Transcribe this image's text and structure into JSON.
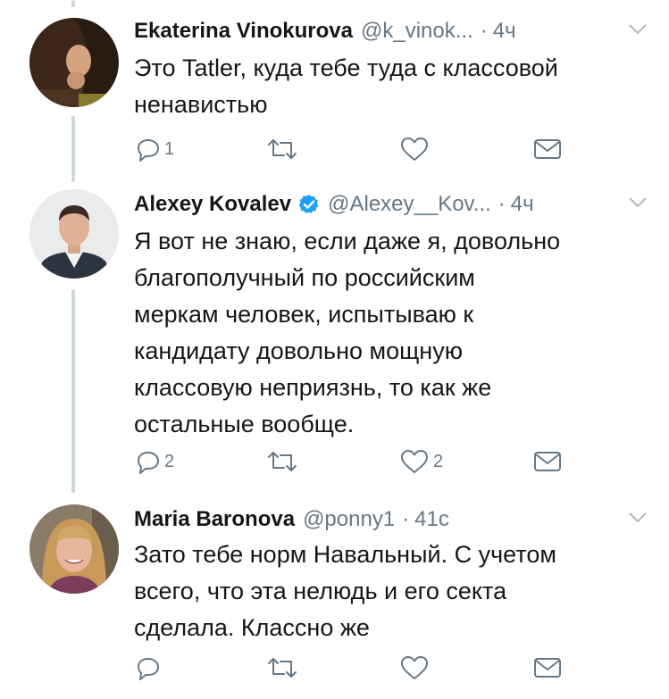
{
  "tweets": [
    {
      "name": "Ekaterina Vinokurova",
      "handle": "@k_vinok...",
      "time": "4ч",
      "verified": false,
      "lines": [
        "Это Tatler, куда тебе туда с классовой",
        "ненавистью"
      ],
      "replies": "1",
      "retweets": "",
      "likes": ""
    },
    {
      "name": "Alexey Kovalev",
      "handle": "@Alexey__Kov...",
      "time": "4ч",
      "verified": true,
      "lines": [
        "Я вот не знаю, если даже я, довольно",
        "благополучный по российским",
        "меркам человек, испытываю к",
        "кандидату довольно мощную",
        "классовую неприязнь, то как же",
        "остальные вообще."
      ],
      "replies": "2",
      "retweets": "",
      "likes": "2"
    },
    {
      "name": "Maria Baronova",
      "handle": "@ponny1",
      "time": "41с",
      "verified": false,
      "lines": [
        "Зато тебе норм Навальный. С учетом",
        "всего, что эта нелюдь и его секта",
        "сделала. Классно же"
      ],
      "replies": "",
      "retweets": "",
      "likes": ""
    }
  ],
  "colors": {
    "text": "#14171a",
    "muted": "#657786",
    "line": "#ccd6dd",
    "verified": "#1da1f2"
  },
  "icons": [
    "reply-icon",
    "retweet-icon",
    "like-icon",
    "message-icon",
    "verified-icon",
    "caret-down-icon"
  ]
}
